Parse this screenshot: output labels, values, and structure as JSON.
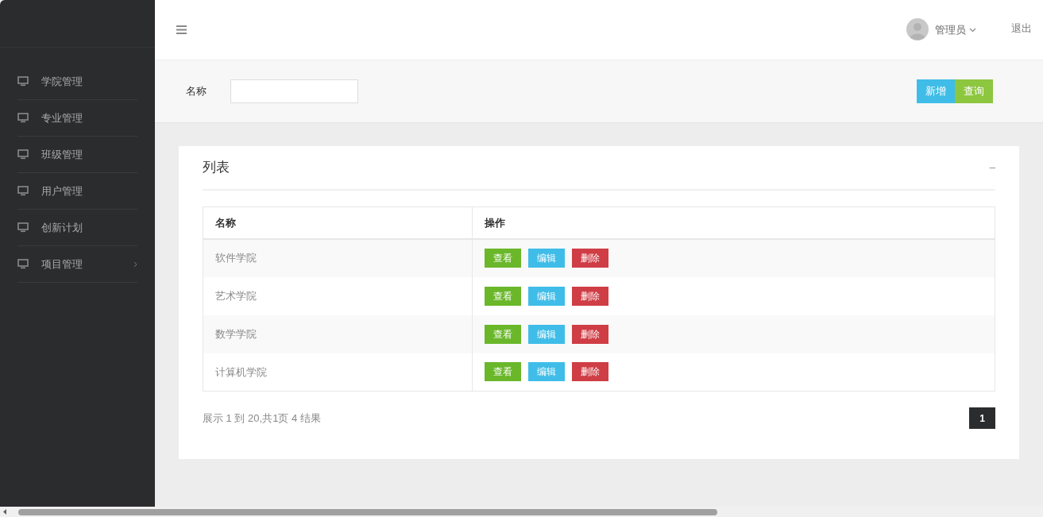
{
  "sidebar": {
    "items": [
      {
        "label": "学院管理",
        "has_children": false
      },
      {
        "label": "专业管理",
        "has_children": false
      },
      {
        "label": "班级管理",
        "has_children": false
      },
      {
        "label": "用户管理",
        "has_children": false
      },
      {
        "label": "创新计划",
        "has_children": false
      },
      {
        "label": "项目管理",
        "has_children": true
      }
    ]
  },
  "header": {
    "user": "管理员",
    "logout": "退出"
  },
  "search": {
    "label": "名称",
    "buttons": [
      {
        "label": "新增",
        "kind": "add"
      },
      {
        "label": "查询",
        "kind": "query"
      }
    ]
  },
  "card": {
    "title": "列表",
    "collapse": "–",
    "table": {
      "columns": [
        "名称",
        "操作"
      ],
      "rows": [
        {
          "name": "软件学院",
          "actions": [
            {
              "label": "查看",
              "kind": "view"
            },
            {
              "label": "编辑",
              "kind": "edit"
            },
            {
              "label": "删除",
              "kind": "delete"
            }
          ]
        },
        {
          "name": "艺术学院",
          "actions": [
            {
              "label": "查看",
              "kind": "view"
            },
            {
              "label": "编辑",
              "kind": "edit"
            },
            {
              "label": "删除",
              "kind": "delete"
            }
          ]
        },
        {
          "name": "数学学院",
          "actions": [
            {
              "label": "查看",
              "kind": "view"
            },
            {
              "label": "编辑",
              "kind": "edit"
            },
            {
              "label": "删除",
              "kind": "delete"
            }
          ]
        },
        {
          "name": "计算机学院",
          "actions": [
            {
              "label": "查看",
              "kind": "view"
            },
            {
              "label": "编辑",
              "kind": "edit"
            },
            {
              "label": "删除",
              "kind": "delete"
            }
          ]
        }
      ]
    },
    "summary": "展示 1 到 20,共1页 4 结果",
    "pages": [
      {
        "label": "1",
        "selected": true
      }
    ]
  }
}
